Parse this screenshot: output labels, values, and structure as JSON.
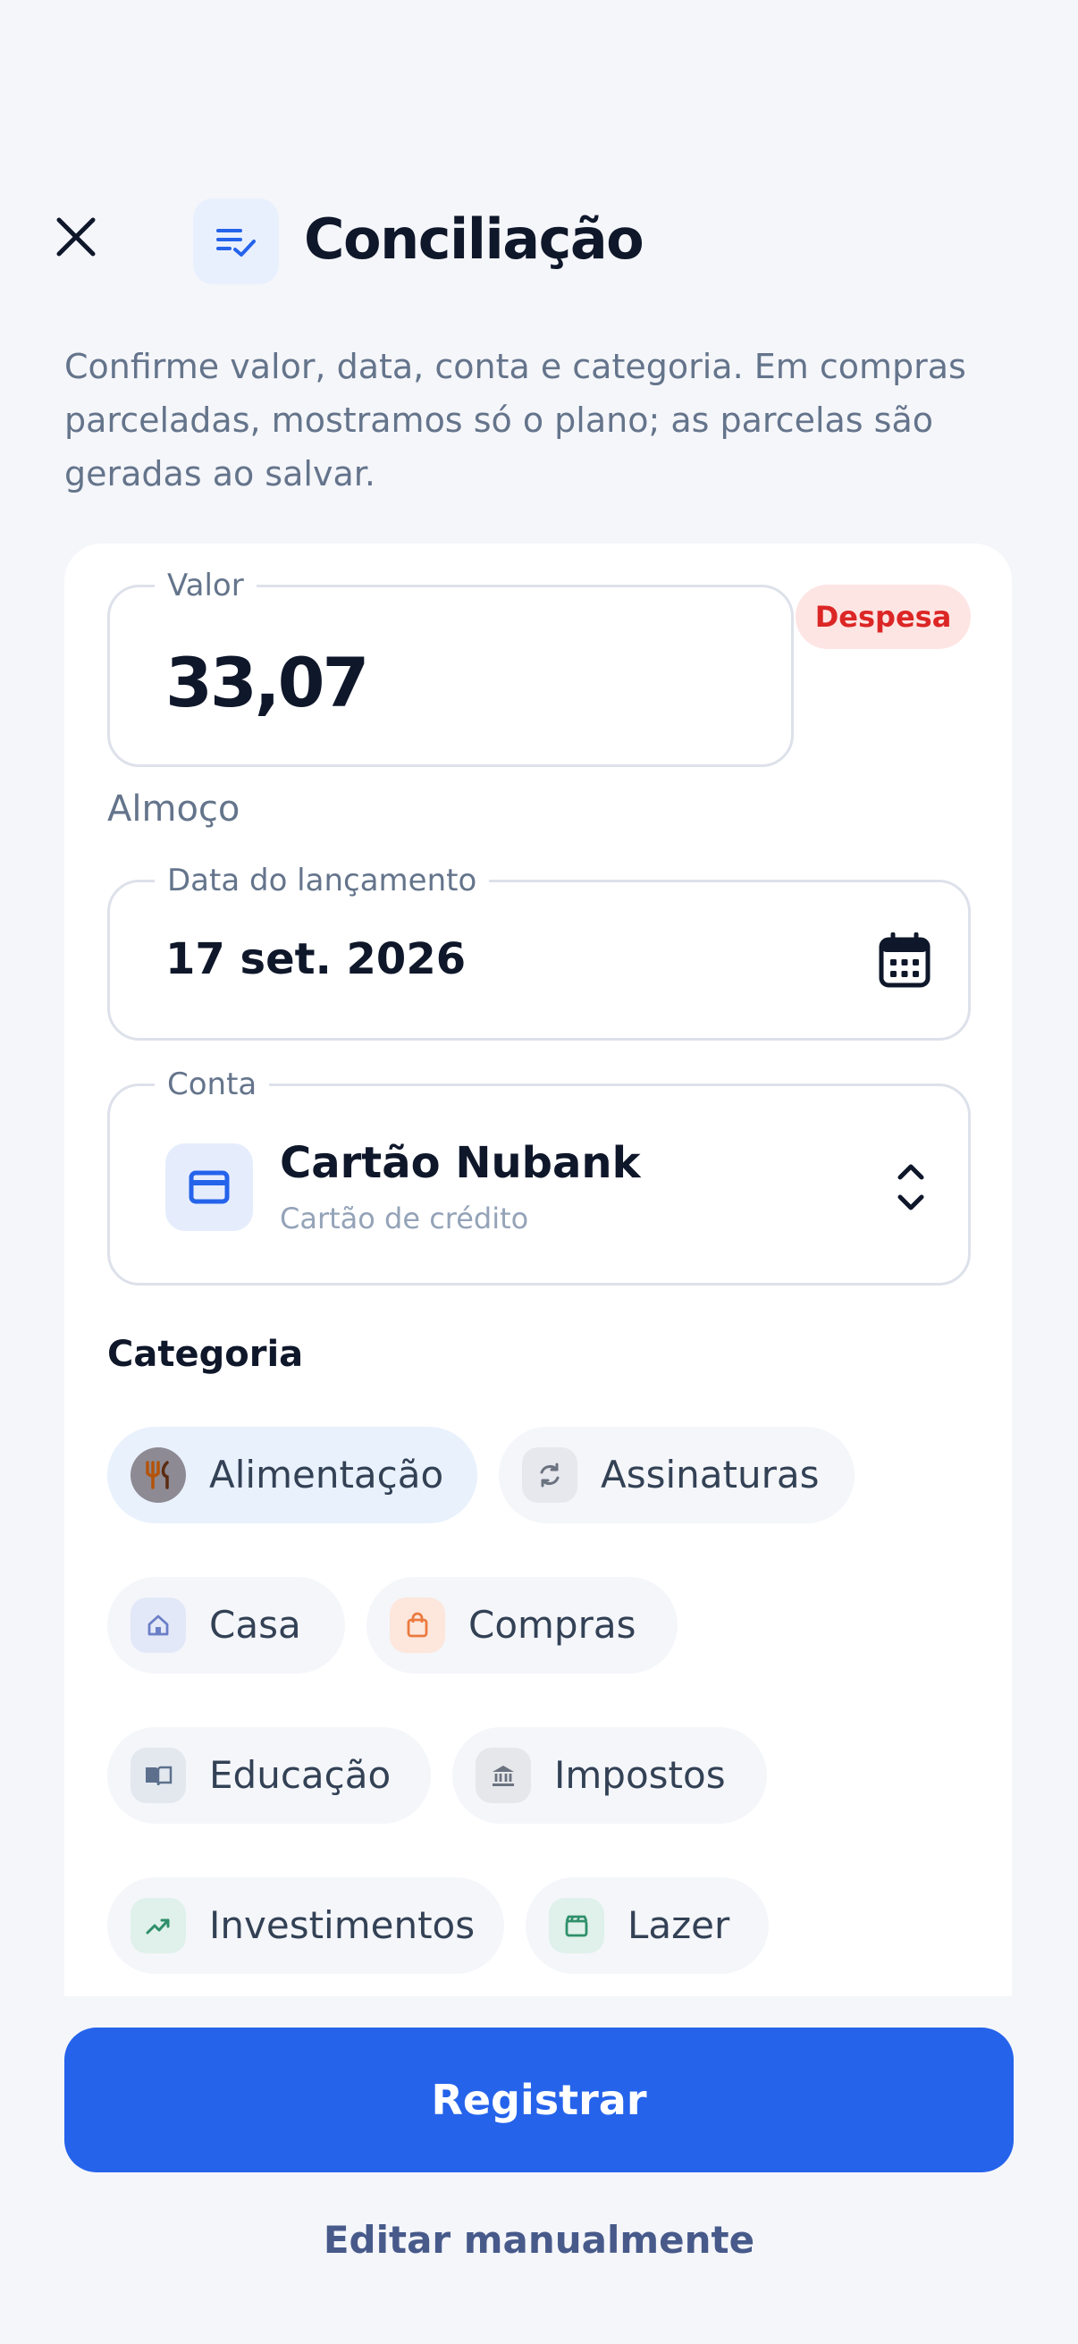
{
  "header": {
    "title": "Conciliação",
    "subtitle": "Confirme valor, data, conta e categoria. Em compras parceladas, mostramos só o plano; as parcelas são geradas ao salvar."
  },
  "form": {
    "valor": {
      "label": "Valor",
      "value": "33,07",
      "badge": "Despesa"
    },
    "description": "Almoço",
    "date": {
      "label": "Data do lançamento",
      "value": "17 set. 2026"
    },
    "account": {
      "label": "Conta",
      "name": "Cartão Nubank",
      "type": "Cartão de crédito"
    },
    "category_label": "Categoria",
    "categories": [
      {
        "label": "Alimentação",
        "icon": "food-icon",
        "selected": true
      },
      {
        "label": "Assinaturas",
        "icon": "refresh-icon",
        "selected": false
      },
      {
        "label": "Casa",
        "icon": "home-icon",
        "selected": false
      },
      {
        "label": "Compras",
        "icon": "shopping-bag-icon",
        "selected": false
      },
      {
        "label": "Educação",
        "icon": "book-icon",
        "selected": false
      },
      {
        "label": "Impostos",
        "icon": "bank-icon",
        "selected": false
      },
      {
        "label": "Investimentos",
        "icon": "trending-up-icon",
        "selected": false
      },
      {
        "label": "Lazer",
        "icon": "clapperboard-icon",
        "selected": false
      }
    ]
  },
  "actions": {
    "primary": "Registrar",
    "secondary": "Editar manualmente"
  },
  "colors": {
    "accent": "#2563eb",
    "expense_badge_bg": "#fde5e3",
    "expense_badge_text": "#dc2626"
  }
}
